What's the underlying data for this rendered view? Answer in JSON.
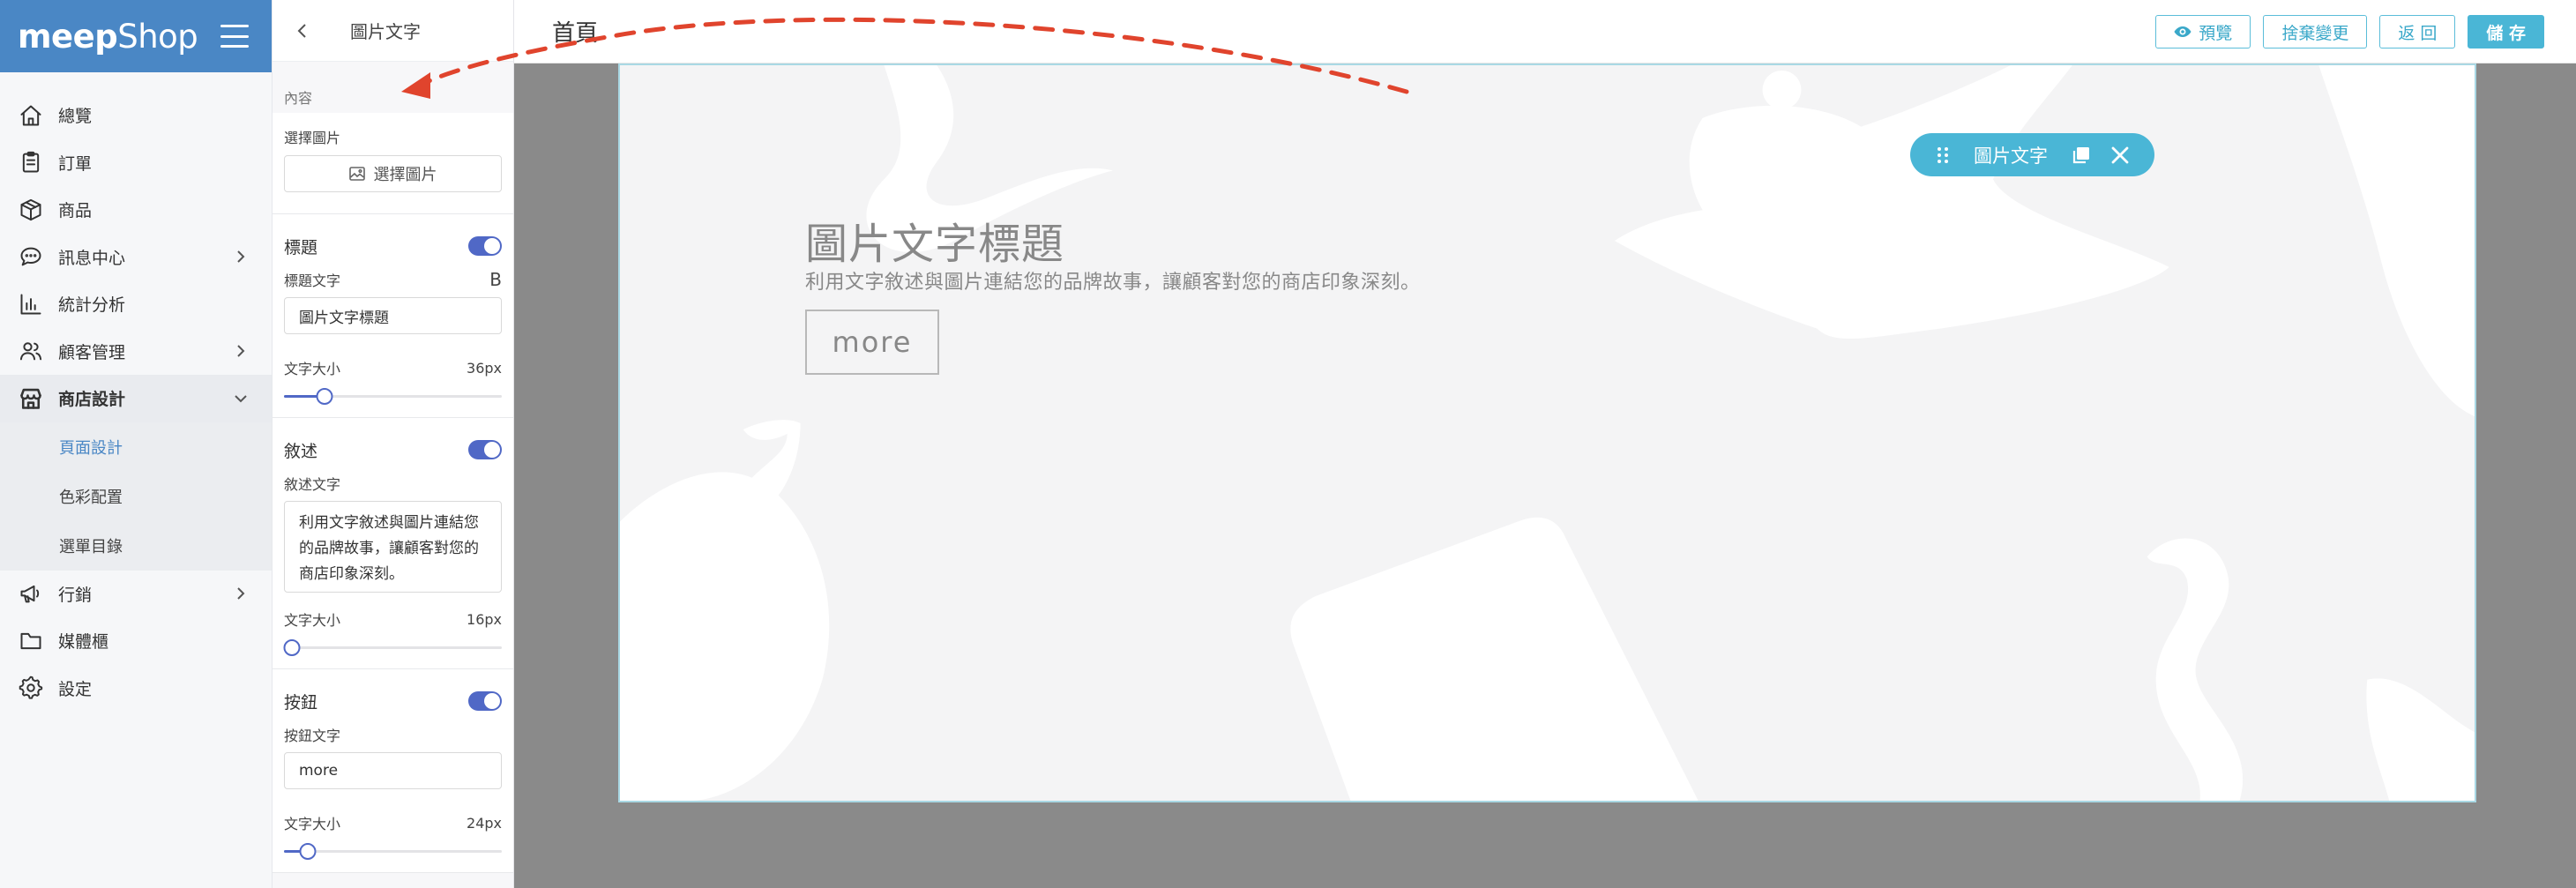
{
  "brand": {
    "logo_bold": "meep",
    "logo_light": "Shop"
  },
  "nav": {
    "items": [
      {
        "label": "總覽",
        "icon": "home-icon"
      },
      {
        "label": "訂單",
        "icon": "clipboard-icon"
      },
      {
        "label": "商品",
        "icon": "box-icon"
      },
      {
        "label": "訊息中心",
        "icon": "chat-icon"
      },
      {
        "label": "統計分析",
        "icon": "bar-chart-icon"
      },
      {
        "label": "顧客管理",
        "icon": "users-icon"
      },
      {
        "label": "商店設計",
        "icon": "store-icon"
      },
      {
        "label": "行銷",
        "icon": "megaphone-icon"
      },
      {
        "label": "媒體櫃",
        "icon": "folder-icon"
      },
      {
        "label": "設定",
        "icon": "gear-icon"
      }
    ],
    "design_sub": [
      {
        "label": "頁面設計"
      },
      {
        "label": "色彩配置"
      },
      {
        "label": "選單目錄"
      }
    ]
  },
  "panel": {
    "title": "圖片文字",
    "section_caption": "內容",
    "image": {
      "label": "選擇圖片",
      "button": "選擇圖片"
    },
    "heading": {
      "label": "標題",
      "text_label": "標題文字",
      "bold_label": "B",
      "value": "圖片文字標題",
      "size_label": "文字大小",
      "size_value": "36px",
      "slider_pct": 18
    },
    "description": {
      "label": "敘述",
      "text_label": "敘述文字",
      "value": "利用文字敘述與圖片連結您的品牌故事，讓顧客對您的商店印象深刻。",
      "size_label": "文字大小",
      "size_value": "16px",
      "slider_pct": 3
    },
    "button": {
      "label": "按鈕",
      "text_label": "按鈕文字",
      "value": "more",
      "size_label": "文字大小",
      "size_value": "24px",
      "slider_pct": 10
    }
  },
  "topbar": {
    "page_name": "首頁",
    "preview": "預覽",
    "discard": "捨棄變更",
    "back": "返 回",
    "save": "儲 存"
  },
  "canvas": {
    "block_name": "圖片文字",
    "hero_title": "圖片文字標題",
    "hero_desc": "利用文字敘述與圖片連結您的品牌故事，讓顧客對您的商店印象深刻。",
    "hero_button": "more"
  },
  "colors": {
    "brand": "#4a87c5",
    "accent": "#4ab6d6",
    "toggle": "#5068c6",
    "annotation": "#e0442d"
  }
}
